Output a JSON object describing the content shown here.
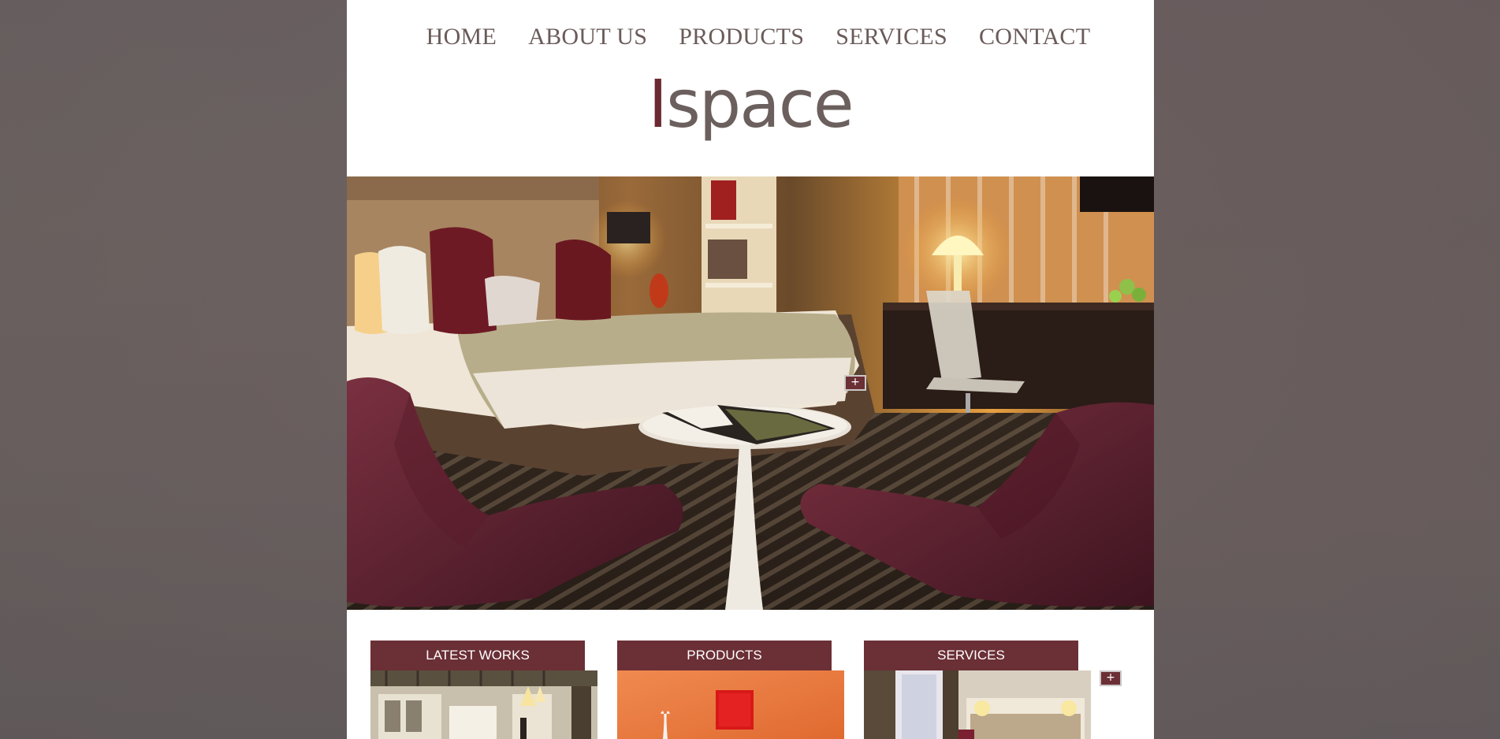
{
  "nav": {
    "items": [
      {
        "label": "HOME"
      },
      {
        "label": "ABOUT US"
      },
      {
        "label": "PRODUCTS"
      },
      {
        "label": "SERVICES"
      },
      {
        "label": "CONTACT"
      }
    ]
  },
  "logo": {
    "first_letter": "I",
    "rest": "space"
  },
  "hero": {
    "plus_label": "+"
  },
  "cards": [
    {
      "title": "LATEST WORKS"
    },
    {
      "title": "PRODUCTS"
    },
    {
      "title": "SERVICES",
      "plus_label": "+"
    }
  ],
  "colors": {
    "accent": "#6b2f36",
    "nav_text": "#6a5b59",
    "logo_first": "#6b2a30",
    "logo_rest": "#6b605d",
    "background": "#655a5b"
  }
}
